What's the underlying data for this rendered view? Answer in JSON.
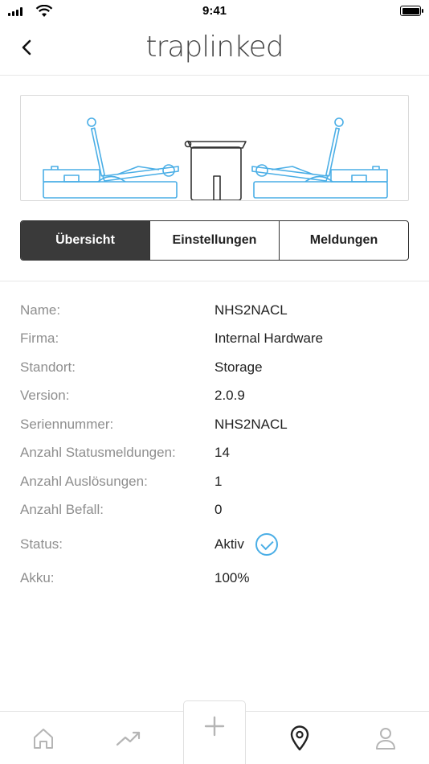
{
  "status_bar": {
    "time": "9:41"
  },
  "header": {
    "logo_text": "traplink",
    "logo_suffix": "ed"
  },
  "tabs": [
    {
      "label": "Übersicht",
      "active": true
    },
    {
      "label": "Einstellungen",
      "active": false
    },
    {
      "label": "Meldungen",
      "active": false
    }
  ],
  "details": {
    "name_label": "Name:",
    "name_value": "NHS2NACL",
    "firma_label": "Firma:",
    "firma_value": "Internal Hardware",
    "standort_label": "Standort:",
    "standort_value": "Storage",
    "version_label": "Version:",
    "version_value": "2.0.9",
    "serial_label": "Seriennummer:",
    "serial_value": "NHS2NACL",
    "status_count_label": "Anzahl Statusmeldungen:",
    "status_count_value": "14",
    "triggers_label": "Anzahl Auslösungen:",
    "triggers_value": "1",
    "infest_label": "Anzahl Befall:",
    "infest_value": "0",
    "status_label": "Status:",
    "status_value": "Aktiv",
    "battery_label": "Akku:",
    "battery_value": "100%"
  },
  "colors": {
    "accent": "#4aaee6",
    "trap_line": "#4aaee6",
    "active_tab": "#3a3a3a"
  },
  "bottom_nav": {
    "items": [
      "home-icon",
      "trend-icon",
      "plus-icon",
      "location-pin-icon",
      "person-icon"
    ],
    "active": "location-pin-icon"
  }
}
